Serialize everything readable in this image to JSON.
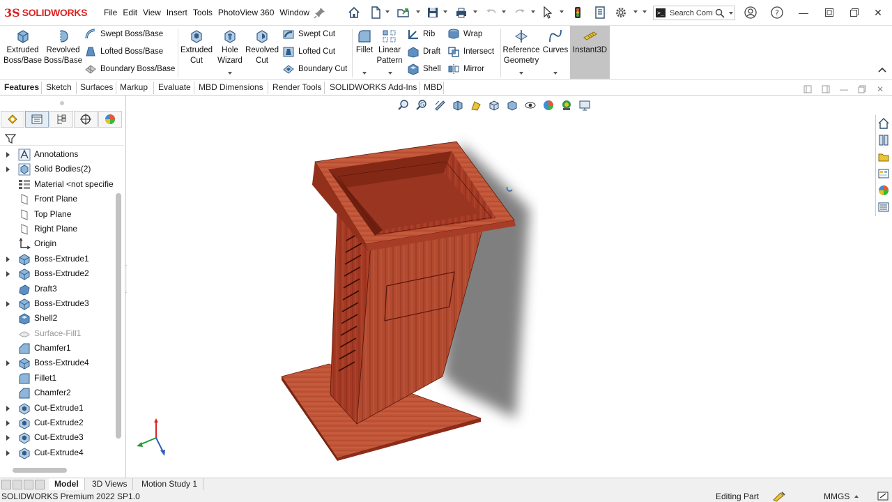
{
  "app": {
    "brand": "SOLIDWORKS",
    "brand_glyph": "3S",
    "menu": [
      "File",
      "Edit",
      "View",
      "Insert",
      "Tools",
      "PhotoView 360",
      "Window"
    ],
    "search_placeholder": "Search Comi"
  },
  "command_manager": {
    "big_buttons": [
      {
        "label1": "Extruded",
        "label2": "Boss/Base"
      },
      {
        "label1": "Revolved",
        "label2": "Boss/Base"
      },
      {
        "label1": "Extruded",
        "label2": "Cut"
      },
      {
        "label1": "Hole",
        "label2": "Wizard"
      },
      {
        "label1": "Revolved",
        "label2": "Cut"
      },
      {
        "label1": "Fillet",
        "label2": ""
      },
      {
        "label1": "Linear",
        "label2": "Pattern"
      },
      {
        "label1": "Reference",
        "label2": "Geometry"
      },
      {
        "label1": "Curves",
        "label2": ""
      },
      {
        "label1": "Instant3D",
        "label2": ""
      }
    ],
    "small_buttons": {
      "swept_boss": "Swept Boss/Base",
      "lofted_boss": "Lofted Boss/Base",
      "boundary_boss": "Boundary Boss/Base",
      "swept_cut": "Swept Cut",
      "lofted_cut": "Lofted Cut",
      "boundary_cut": "Boundary Cut",
      "rib": "Rib",
      "draft": "Draft",
      "shell": "Shell",
      "wrap": "Wrap",
      "intersect": "Intersect",
      "mirror": "Mirror"
    }
  },
  "tabs": [
    "Features",
    "Sketch",
    "Surfaces",
    "Markup",
    "Evaluate",
    "MBD Dimensions",
    "Render Tools",
    "SOLIDWORKS Add-Ins",
    "MBD"
  ],
  "active_tab": "Features",
  "tree": [
    {
      "label": "Annotations",
      "icon": "annotations-icon",
      "expandable": true,
      "dim": false
    },
    {
      "label": "Solid Bodies(2)",
      "icon": "solid-bodies-icon",
      "expandable": true,
      "dim": false
    },
    {
      "label": "Material <not specifie",
      "icon": "material-icon",
      "expandable": false,
      "dim": false
    },
    {
      "label": "Front Plane",
      "icon": "plane-icon",
      "expandable": false,
      "dim": false
    },
    {
      "label": "Top Plane",
      "icon": "plane-icon",
      "expandable": false,
      "dim": false
    },
    {
      "label": "Right Plane",
      "icon": "plane-icon",
      "expandable": false,
      "dim": false
    },
    {
      "label": "Origin",
      "icon": "origin-icon",
      "expandable": false,
      "dim": false
    },
    {
      "label": "Boss-Extrude1",
      "icon": "extrude-icon",
      "expandable": true,
      "dim": false
    },
    {
      "label": "Boss-Extrude2",
      "icon": "extrude-icon",
      "expandable": true,
      "dim": false
    },
    {
      "label": "Draft3",
      "icon": "draft-icon",
      "expandable": false,
      "dim": false
    },
    {
      "label": "Boss-Extrude3",
      "icon": "extrude-icon",
      "expandable": true,
      "dim": false
    },
    {
      "label": "Shell2",
      "icon": "shell-icon",
      "expandable": false,
      "dim": false
    },
    {
      "label": "Surface-Fill1",
      "icon": "surface-fill-icon",
      "expandable": false,
      "dim": true
    },
    {
      "label": "Chamfer1",
      "icon": "chamfer-icon",
      "expandable": false,
      "dim": false
    },
    {
      "label": "Boss-Extrude4",
      "icon": "extrude-icon",
      "expandable": true,
      "dim": false
    },
    {
      "label": "Fillet1",
      "icon": "fillet-icon",
      "expandable": false,
      "dim": false
    },
    {
      "label": "Chamfer2",
      "icon": "chamfer-icon",
      "expandable": false,
      "dim": false
    },
    {
      "label": "Cut-Extrude1",
      "icon": "cut-extrude-icon",
      "expandable": true,
      "dim": false
    },
    {
      "label": "Cut-Extrude2",
      "icon": "cut-extrude-icon",
      "expandable": true,
      "dim": false
    },
    {
      "label": "Cut-Extrude3",
      "icon": "cut-extrude-icon",
      "expandable": true,
      "dim": false
    },
    {
      "label": "Cut-Extrude4",
      "icon": "cut-extrude-icon",
      "expandable": true,
      "dim": false
    }
  ],
  "bottom_tabs": [
    "Model",
    "3D Views",
    "Motion Study 1"
  ],
  "active_bottom_tab": "Model",
  "status": {
    "version": "SOLIDWORKS Premium 2022 SP1.0",
    "mode": "Editing Part",
    "units": "MMGS"
  },
  "colors": {
    "brand_red": "#dd2222",
    "wood_dark": "#7e2416",
    "wood_mid": "#b2442c",
    "wood_light": "#cf6448",
    "selected_tab_bg": "#c4c4c4"
  }
}
